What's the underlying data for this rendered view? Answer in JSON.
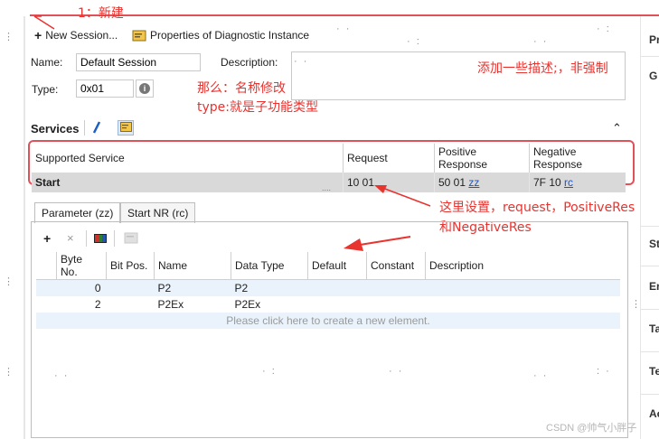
{
  "annotations": {
    "new_label": "1：新建",
    "name_note_line1": "那么：名称修改",
    "name_note_line2": "type:就是子功能类型",
    "desc_note": "添加一些描述;，非强制",
    "table_note_line1": "这里设置，request，PositiveRes",
    "table_note_line2": "和NegativeRes"
  },
  "toolbar": {
    "new_session": "New Session...",
    "properties": "Properties of Diagnostic Instance"
  },
  "form": {
    "name_label": "Name:",
    "name_value": "Default Session",
    "description_label": "Description:",
    "type_label": "Type:",
    "type_value": "0x01"
  },
  "services": {
    "title": "Services",
    "columns": [
      "Supported Service",
      "Request",
      "Positive Response",
      "Negative Response"
    ],
    "row": {
      "service": "Start",
      "request": "10 01",
      "positive_prefix": "50 01",
      "positive_link": "zz",
      "negative_prefix": "7F 10",
      "negative_link": "rc"
    },
    "splitter": "...."
  },
  "tabs": [
    "Parameter (zz)",
    "Start NR (rc)"
  ],
  "param_table": {
    "columns": [
      "Byte No.",
      "Bit Pos.",
      "Name",
      "Data Type",
      "Default",
      "Constant",
      "Description"
    ],
    "rows": [
      {
        "byte": "0",
        "bit": "",
        "name": "P2",
        "type": "P2"
      },
      {
        "byte": "2",
        "bit": "",
        "name": "P2Ex",
        "type": "P2Ex"
      }
    ],
    "hint": "Please click here to create a new element."
  },
  "right_panel": {
    "items": [
      "Pr",
      "G",
      "St",
      "Er",
      "Ta",
      "Te",
      "Ac"
    ]
  },
  "watermark": "CSDN @帅气小胖子",
  "colors": {
    "annotation_red": "#e8332f",
    "highlight_border": "#e0525a",
    "link_blue": "#1a55c8",
    "selected_row": "#d9d9d9",
    "alt_row": "#eaf3fb"
  }
}
